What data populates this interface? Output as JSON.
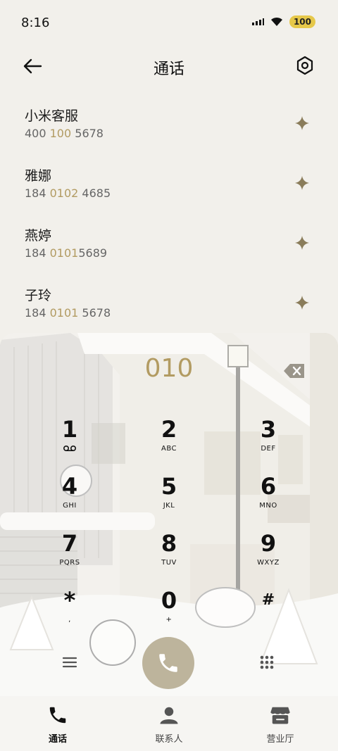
{
  "status_bar": {
    "time": "8:16",
    "battery": "100"
  },
  "header": {
    "title": "通话"
  },
  "results": [
    {
      "name": "小米客服",
      "num_pre": "400 ",
      "num_hl": "100",
      "num_post": " 5678"
    },
    {
      "name": "雅娜",
      "num_pre": "184 ",
      "num_hl": "0102",
      "num_post": " 4685"
    },
    {
      "name": "燕婷",
      "num_pre": "184 ",
      "num_hl": "0101",
      "num_post": "5689"
    },
    {
      "name": "子玲",
      "num_pre": "184 ",
      "num_hl": "0101",
      "num_post": " 5678"
    }
  ],
  "dialpad": {
    "input": "010",
    "keys": [
      {
        "digit": "1",
        "letters": ""
      },
      {
        "digit": "2",
        "letters": "ABC"
      },
      {
        "digit": "3",
        "letters": "DEF"
      },
      {
        "digit": "4",
        "letters": "GHI"
      },
      {
        "digit": "5",
        "letters": "JKL"
      },
      {
        "digit": "6",
        "letters": "MNO"
      },
      {
        "digit": "7",
        "letters": "PQRS"
      },
      {
        "digit": "8",
        "letters": "TUV"
      },
      {
        "digit": "9",
        "letters": "WXYZ"
      },
      {
        "digit": "*",
        "letters": ","
      },
      {
        "digit": "0",
        "letters": "+"
      },
      {
        "digit": "#",
        "letters": ""
      }
    ]
  },
  "bottom_nav": [
    {
      "label": "通话",
      "icon": "phone-icon"
    },
    {
      "label": "联系人",
      "icon": "person-icon"
    },
    {
      "label": "营业厅",
      "icon": "store-icon"
    }
  ],
  "colors": {
    "accent": "#b29b62",
    "call_button": "#bdb49c"
  }
}
